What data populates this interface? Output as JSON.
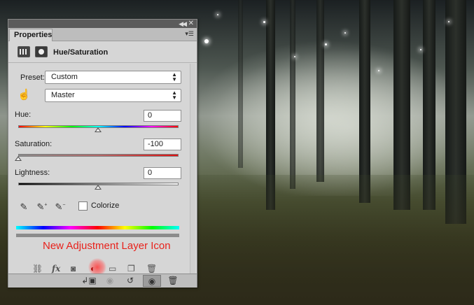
{
  "panel": {
    "tab_label": "Properties",
    "title": "Hue/Saturation"
  },
  "preset": {
    "label": "Preset:",
    "value": "Custom"
  },
  "channel": {
    "value": "Master"
  },
  "hue": {
    "label": "Hue:",
    "value": "0"
  },
  "saturation": {
    "label": "Saturation:",
    "value": "-100"
  },
  "lightness": {
    "label": "Lightness:",
    "value": "0"
  },
  "colorize": {
    "label": "Colorize",
    "checked": false
  },
  "annotation": {
    "text": "New Adjustment Layer Icon",
    "color": "#e8221c"
  },
  "layers_icons": {
    "link": "link-icon",
    "fx": "fx",
    "mask": "add-mask-icon",
    "adjustment": "new-adjustment-layer-icon",
    "group": "folder-icon",
    "new_layer": "new-layer-icon",
    "delete": "trash-icon"
  },
  "bottom_bar": {
    "clip": "clip-to-layer-icon",
    "view_previous": "view-previous-icon",
    "reset": "reset-icon",
    "visibility": "eye-icon",
    "delete": "trash-icon"
  }
}
